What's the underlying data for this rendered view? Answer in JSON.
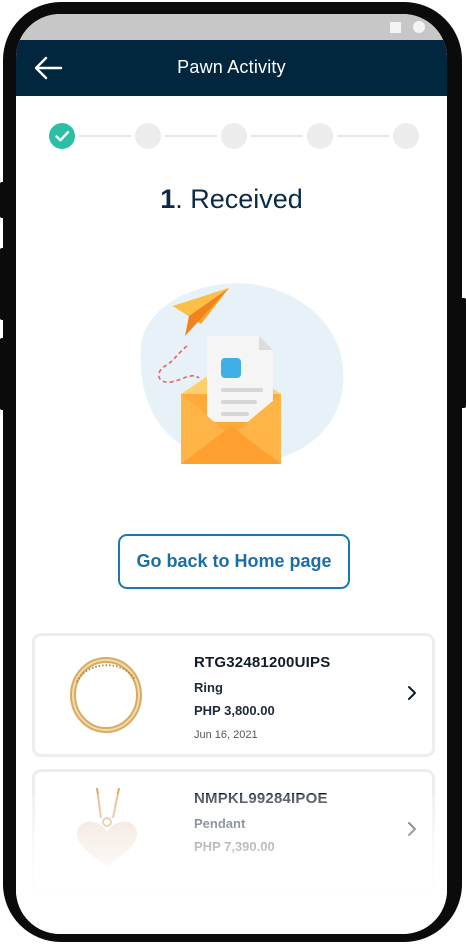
{
  "app_bar": {
    "title": "Pawn Activity"
  },
  "stepper": {
    "total_steps": 5,
    "completed_steps": 1
  },
  "status": {
    "number": "1",
    "label": ". Received"
  },
  "home_button": {
    "label": "Go back to Home page"
  },
  "items": [
    {
      "code": "RTG32481200UIPS",
      "type": "Ring",
      "amount": "PHP 3,800.00",
      "date": "Jun 16, 2021"
    },
    {
      "code": "NMPKL99284IPOE",
      "type": "Pendant",
      "amount": "PHP 7,390.00",
      "date": ""
    }
  ],
  "colors": {
    "app_bar": "#03263f",
    "step_done": "#2dbfa5",
    "step_pending": "#ececec",
    "button_border": "#1b78b0",
    "button_text": "#1b6fa3"
  },
  "icons": {
    "back": "arrow-left-icon",
    "step_done": "check-icon",
    "item_open": "chevron-right-icon"
  }
}
